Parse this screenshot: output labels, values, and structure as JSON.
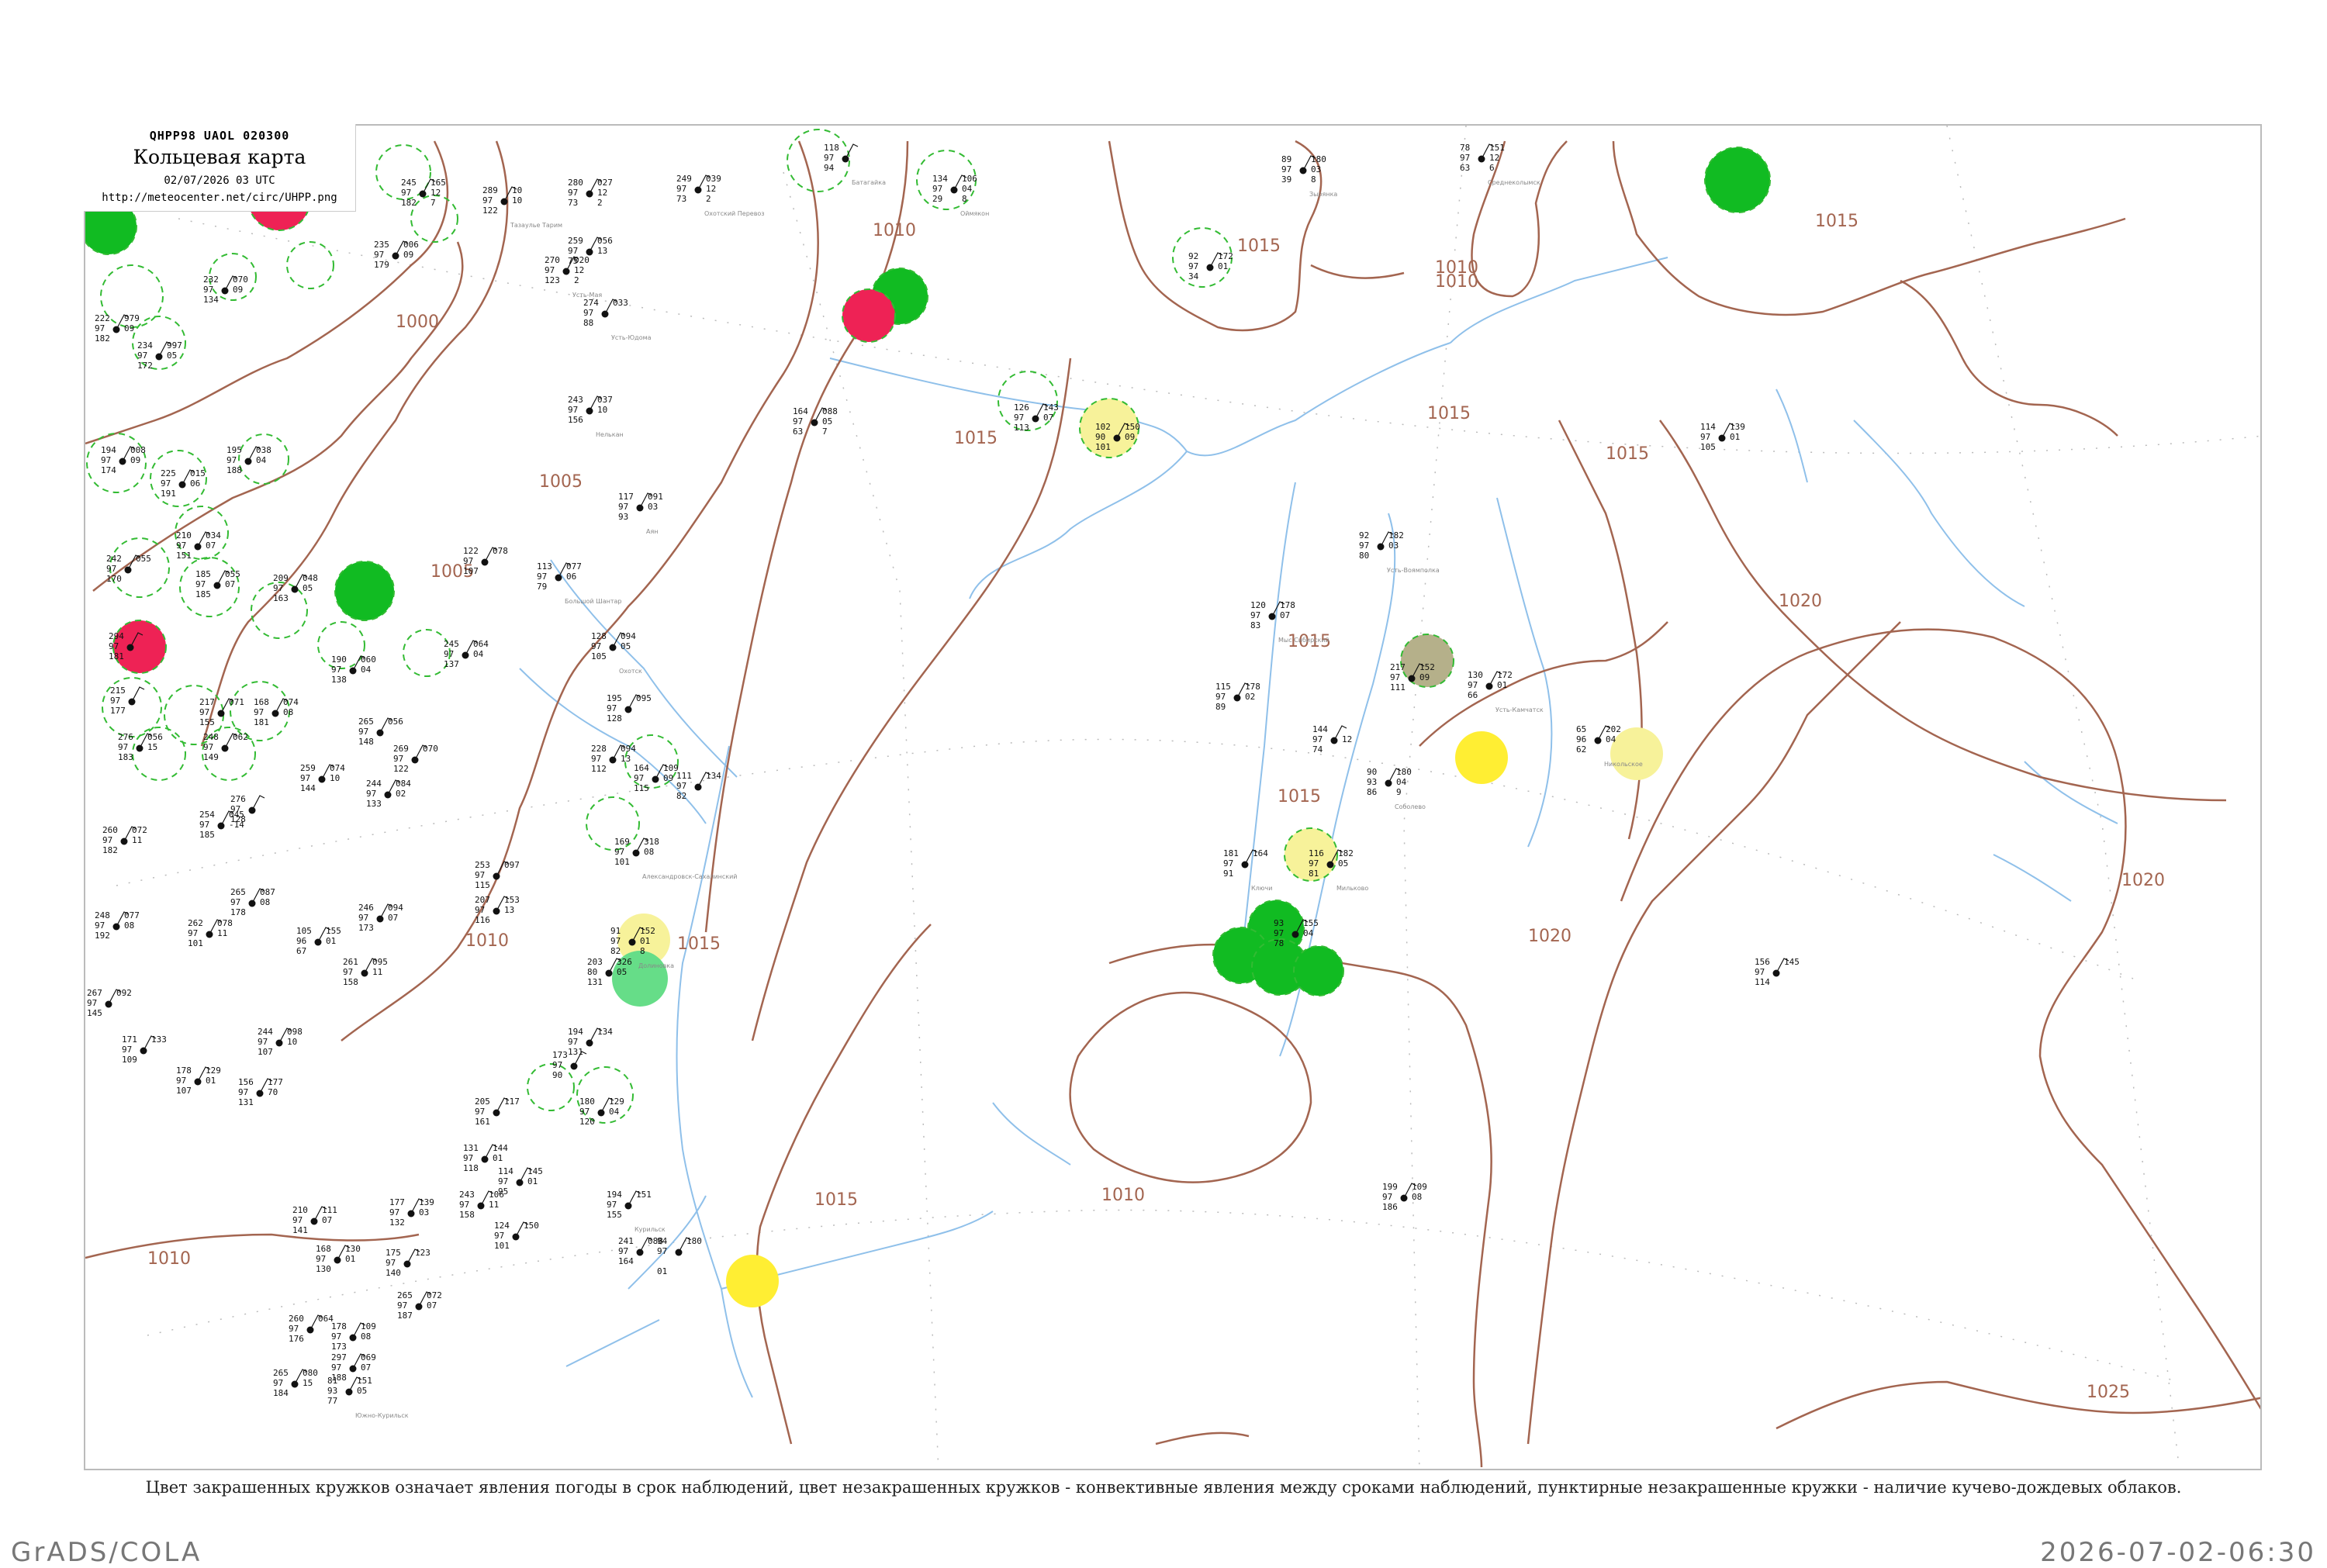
{
  "header": {
    "code": "QHPP98  UAOL  020300",
    "title": "Кольцевая карта",
    "time": "02/07/2026 03 UTC",
    "url": "http://meteocenter.net/circ/UHPP.png"
  },
  "caption": "Цвет закрашенных кружков означает явления погоды в срок наблюдений, цвет незакрашенных кружков - конвективные явления между сроками наблюдений, пунктирные незакрашенные кружки - наличие кучево-дождевых облаков.",
  "footer": {
    "left": "GrADS/COLA",
    "right": "2026-07-02-06:30"
  },
  "colors": {
    "isobar": "#a36550",
    "river": "#8fc0ea",
    "green": "#11bb22",
    "red": "#ee2255",
    "yellow": "#ffee33",
    "pale_yellow": "#f7f29a",
    "light_green": "#66dd88",
    "olive": "#b5b08a",
    "dashed_ring": "#33bb33"
  },
  "isobar_labels": [
    "1000",
    "1005",
    "1005",
    "1010",
    "1010",
    "1010",
    "1010",
    "1015",
    "1015",
    "1015",
    "1015",
    "1015",
    "1015",
    "1015",
    "1015",
    "1015",
    "1020",
    "1020",
    "1020",
    "1025",
    "1010",
    "1010"
  ],
  "stations": [
    {
      "values": [
        "245",
        "97",
        "182"
      ],
      "v2": [
        "165",
        "12",
        "7"
      ],
      "name": ""
    },
    {
      "values": [
        "289",
        "97",
        "122"
      ],
      "v2": [
        "10",
        "10",
        ""
      ],
      "name": "Тазаулье Тарим"
    },
    {
      "values": [
        "280",
        "97",
        "73"
      ],
      "v2": [
        "027",
        "12",
        "2"
      ],
      "name": ""
    },
    {
      "values": [
        "249",
        "97",
        "73"
      ],
      "v2": [
        "039",
        "12",
        "2"
      ],
      "name": "Охотский Перевоз"
    },
    {
      "values": [
        "118",
        "97",
        "94"
      ],
      "v2": [
        "",
        "",
        ""
      ],
      "name": "Батагайка"
    },
    {
      "values": [
        "134",
        "97",
        "29"
      ],
      "v2": [
        "106",
        "04",
        "8"
      ],
      "name": "Оймякон"
    },
    {
      "values": [
        "89",
        "97",
        "39"
      ],
      "v2": [
        "180",
        "03",
        "8"
      ],
      "name": "Зырянка"
    },
    {
      "values": [
        "78",
        "97",
        "63"
      ],
      "v2": [
        "151",
        "12",
        "6"
      ],
      "name": "Среднеколымск"
    },
    {
      "values": [
        "235",
        "97",
        "179"
      ],
      "v2": [
        "006",
        "09",
        ""
      ],
      "name": ""
    },
    {
      "values": [
        "232",
        "97",
        "134"
      ],
      "v2": [
        "070",
        "09",
        ""
      ],
      "name": ""
    },
    {
      "values": [
        "222",
        "97",
        "182"
      ],
      "v2": [
        "979",
        "09",
        ""
      ],
      "name": ""
    },
    {
      "values": [
        "234",
        "97",
        "172"
      ],
      "v2": [
        "997",
        "05",
        ""
      ],
      "name": ""
    },
    {
      "values": [
        "270",
        "97",
        "123"
      ],
      "v2": [
        "020",
        "12",
        "2"
      ],
      "name": "Усть-Мая"
    },
    {
      "values": [
        "259",
        "97",
        "75"
      ],
      "v2": [
        "056",
        "13",
        ""
      ],
      "name": ""
    },
    {
      "values": [
        "274",
        "97",
        "88"
      ],
      "v2": [
        "033",
        "",
        ""
      ],
      "name": "Усть-Юдома"
    },
    {
      "values": [
        "243",
        "97",
        "156"
      ],
      "v2": [
        "037",
        "10",
        ""
      ],
      "name": "Нелькан"
    },
    {
      "values": [
        "164",
        "97",
        "63"
      ],
      "v2": [
        "088",
        "05",
        "7"
      ],
      "name": ""
    },
    {
      "values": [
        "126",
        "97",
        "113"
      ],
      "v2": [
        "143",
        "07",
        ""
      ],
      "name": ""
    },
    {
      "values": [
        "102",
        "90",
        "101"
      ],
      "v2": [
        "150",
        "09",
        ""
      ],
      "name": ""
    },
    {
      "values": [
        "92",
        "97",
        "34"
      ],
      "v2": [
        "172",
        "01",
        ""
      ],
      "name": ""
    },
    {
      "values": [
        "114",
        "97",
        "105"
      ],
      "v2": [
        "139",
        "01",
        ""
      ],
      "name": ""
    },
    {
      "values": [
        "194",
        "97",
        "174"
      ],
      "v2": [
        "008",
        "09",
        ""
      ],
      "name": ""
    },
    {
      "values": [
        "225",
        "97",
        "191"
      ],
      "v2": [
        "015",
        "06",
        ""
      ],
      "name": ""
    },
    {
      "values": [
        "195",
        "97",
        "188"
      ],
      "v2": [
        "038",
        "04",
        ""
      ],
      "name": ""
    },
    {
      "values": [
        "117",
        "97",
        "93"
      ],
      "v2": [
        "091",
        "03",
        ""
      ],
      "name": "Аян"
    },
    {
      "values": [
        "210",
        "97",
        "151"
      ],
      "v2": [
        "034",
        "07",
        ""
      ],
      "name": ""
    },
    {
      "values": [
        "242",
        "97",
        "170"
      ],
      "v2": [
        "055",
        "",
        ""
      ],
      "name": ""
    },
    {
      "values": [
        "185",
        "97",
        "185"
      ],
      "v2": [
        "055",
        "07",
        ""
      ],
      "name": ""
    },
    {
      "values": [
        "113",
        "97",
        "79"
      ],
      "v2": [
        "077",
        "06",
        ""
      ],
      "name": "Большой Шантар"
    },
    {
      "values": [
        "122",
        "97",
        "107"
      ],
      "v2": [
        "078",
        "",
        ""
      ],
      "name": ""
    },
    {
      "values": [
        "209",
        "97",
        "163"
      ],
      "v2": [
        "048",
        "05",
        ""
      ],
      "name": ""
    },
    {
      "values": [
        "92",
        "97",
        "80"
      ],
      "v2": [
        "182",
        "03",
        ""
      ],
      "name": "Усть-Воямполка"
    },
    {
      "values": [
        "120",
        "97",
        "83"
      ],
      "v2": [
        "178",
        "07",
        ""
      ],
      "name": "Мыс Сибирский"
    },
    {
      "values": [
        "294",
        "97",
        "181"
      ],
      "v2": [
        "",
        "",
        ""
      ],
      "name": ""
    },
    {
      "values": [
        "245",
        "97",
        "137"
      ],
      "v2": [
        "064",
        "04",
        ""
      ],
      "name": ""
    },
    {
      "values": [
        "190",
        "97",
        "138"
      ],
      "v2": [
        "060",
        "04",
        ""
      ],
      "name": ""
    },
    {
      "values": [
        "128",
        "97",
        "105"
      ],
      "v2": [
        "094",
        "05",
        ""
      ],
      "name": "Охотск"
    },
    {
      "values": [
        "217",
        "97",
        "111"
      ],
      "v2": [
        "152",
        "09",
        ""
      ],
      "name": ""
    },
    {
      "values": [
        "130",
        "97",
        "66"
      ],
      "v2": [
        "172",
        "01",
        ""
      ],
      "name": "Усть-Камчатск"
    },
    {
      "values": [
        "115",
        "97",
        "89"
      ],
      "v2": [
        "178",
        "02",
        ""
      ],
      "name": ""
    },
    {
      "values": [
        "215",
        "97",
        "177"
      ],
      "v2": [
        "",
        "",
        ""
      ],
      "name": ""
    },
    {
      "values": [
        "217",
        "97",
        "155"
      ],
      "v2": [
        "071",
        "",
        ""
      ],
      "name": ""
    },
    {
      "values": [
        "168",
        "97",
        "181"
      ],
      "v2": [
        "074",
        "08",
        ""
      ],
      "name": ""
    },
    {
      "values": [
        "195",
        "97",
        "128"
      ],
      "v2": [
        "095",
        "",
        ""
      ],
      "name": ""
    },
    {
      "values": [
        "265",
        "97",
        "148"
      ],
      "v2": [
        "056",
        "",
        ""
      ],
      "name": ""
    },
    {
      "values": [
        "144",
        "97",
        "74"
      ],
      "v2": [
        "",
        "12",
        ""
      ],
      "name": ""
    },
    {
      "values": [
        "65",
        "96",
        "62"
      ],
      "v2": [
        "202",
        "04",
        ""
      ],
      "name": "Никольское"
    },
    {
      "values": [
        "276",
        "97",
        "183"
      ],
      "v2": [
        "056",
        "15",
        ""
      ],
      "name": ""
    },
    {
      "values": [
        "248",
        "97",
        "149"
      ],
      "v2": [
        "062",
        "",
        ""
      ],
      "name": ""
    },
    {
      "values": [
        "228",
        "97",
        "112"
      ],
      "v2": [
        "094",
        "13",
        ""
      ],
      "name": ""
    },
    {
      "values": [
        "269",
        "97",
        "122"
      ],
      "v2": [
        "070",
        "",
        ""
      ],
      "name": ""
    },
    {
      "values": [
        "164",
        "97",
        "115"
      ],
      "v2": [
        "109",
        "09",
        ""
      ],
      "name": ""
    },
    {
      "values": [
        "90",
        "93",
        "86"
      ],
      "v2": [
        "180",
        "04",
        "9"
      ],
      "name": "Соболево"
    },
    {
      "values": [
        "259",
        "97",
        "144"
      ],
      "v2": [
        "074",
        "10",
        ""
      ],
      "name": ""
    },
    {
      "values": [
        "244",
        "97",
        "133"
      ],
      "v2": [
        "084",
        "02",
        ""
      ],
      "name": ""
    },
    {
      "values": [
        "111",
        "97",
        "82"
      ],
      "v2": [
        "134",
        "",
        ""
      ],
      "name": ""
    },
    {
      "values": [
        "276",
        "97",
        "128"
      ],
      "v2": [
        "",
        "",
        ""
      ],
      "name": ""
    },
    {
      "values": [
        "254",
        "97",
        "185"
      ],
      "v2": [
        "045",
        "-14",
        ""
      ],
      "name": ""
    },
    {
      "values": [
        "260",
        "97",
        "182"
      ],
      "v2": [
        "072",
        "11",
        ""
      ],
      "name": ""
    },
    {
      "values": [
        "248",
        "97",
        "192"
      ],
      "v2": [
        "077",
        "08",
        ""
      ],
      "name": ""
    },
    {
      "values": [
        "169",
        "97",
        "101"
      ],
      "v2": [
        "318",
        "08",
        ""
      ],
      "name": "Александровск-Сахалинский"
    },
    {
      "values": [
        "116",
        "97",
        "81"
      ],
      "v2": [
        "182",
        "05",
        ""
      ],
      "name": "Мильково"
    },
    {
      "values": [
        "181",
        "97",
        "91"
      ],
      "v2": [
        "164",
        "",
        ""
      ],
      "name": "Ключи"
    },
    {
      "values": [
        "265",
        "97",
        "178"
      ],
      "v2": [
        "087",
        "08",
        ""
      ],
      "name": ""
    },
    {
      "values": [
        "253",
        "97",
        "115"
      ],
      "v2": [
        "097",
        "",
        ""
      ],
      "name": ""
    },
    {
      "values": [
        "207",
        "97",
        "116"
      ],
      "v2": [
        "153",
        "13",
        ""
      ],
      "name": ""
    },
    {
      "values": [
        "246",
        "97",
        "173"
      ],
      "v2": [
        "094",
        "07",
        ""
      ],
      "name": ""
    },
    {
      "values": [
        "262",
        "97",
        "101"
      ],
      "v2": [
        "078",
        "11",
        ""
      ],
      "name": ""
    },
    {
      "values": [
        "105",
        "96",
        "67"
      ],
      "v2": [
        "155",
        "01",
        ""
      ],
      "name": ""
    },
    {
      "values": [
        "91",
        "97",
        "82"
      ],
      "v2": [
        "152",
        "01",
        "8"
      ],
      "name": "Долиновка"
    },
    {
      "values": [
        "93",
        "97",
        "78"
      ],
      "v2": [
        "155",
        "04",
        ""
      ],
      "name": ""
    },
    {
      "values": [
        "203",
        "80",
        "131"
      ],
      "v2": [
        "326",
        "05",
        ""
      ],
      "name": ""
    },
    {
      "values": [
        "194",
        "97",
        "131"
      ],
      "v2": [
        "134",
        "",
        ""
      ],
      "name": ""
    },
    {
      "values": [
        "173",
        "97",
        "90"
      ],
      "v2": [
        "",
        "",
        ""
      ],
      "name": ""
    },
    {
      "values": [
        "244",
        "97",
        "107"
      ],
      "v2": [
        "098",
        "10",
        ""
      ],
      "name": ""
    },
    {
      "values": [
        "261",
        "97",
        "158"
      ],
      "v2": [
        "095",
        "11",
        ""
      ],
      "name": ""
    },
    {
      "values": [
        "267",
        "97",
        "145"
      ],
      "v2": [
        "092",
        "",
        ""
      ],
      "name": ""
    },
    {
      "values": [
        "171",
        "97",
        "109"
      ],
      "v2": [
        "133",
        "",
        ""
      ],
      "name": ""
    },
    {
      "values": [
        "178",
        "97",
        "107"
      ],
      "v2": [
        "129",
        "01",
        ""
      ],
      "name": ""
    },
    {
      "values": [
        "156",
        "97",
        "131"
      ],
      "v2": [
        "177",
        "70",
        ""
      ],
      "name": ""
    },
    {
      "values": [
        "156",
        "97",
        "114"
      ],
      "v2": [
        "145",
        "",
        ""
      ],
      "name": ""
    },
    {
      "values": [
        "180",
        "97",
        "120"
      ],
      "v2": [
        "129",
        "04",
        ""
      ],
      "name": ""
    },
    {
      "values": [
        "205",
        "97",
        "161"
      ],
      "v2": [
        "117",
        "",
        ""
      ],
      "name": ""
    },
    {
      "values": [
        "131",
        "97",
        "118"
      ],
      "v2": [
        "144",
        "01",
        ""
      ],
      "name": ""
    },
    {
      "values": [
        "243",
        "97",
        "158"
      ],
      "v2": [
        "106",
        "11",
        ""
      ],
      "name": ""
    },
    {
      "values": [
        "114",
        "97",
        "95"
      ],
      "v2": [
        "145",
        "01",
        ""
      ],
      "name": ""
    },
    {
      "values": [
        "194",
        "97",
        "155"
      ],
      "v2": [
        "151",
        "",
        ""
      ],
      "name": "Курильск"
    },
    {
      "values": [
        "199",
        "97",
        "186"
      ],
      "v2": [
        "109",
        "08",
        ""
      ],
      "name": ""
    },
    {
      "values": [
        "210",
        "97",
        "141"
      ],
      "v2": [
        "111",
        "07",
        ""
      ],
      "name": ""
    },
    {
      "values": [
        "177",
        "97",
        "132"
      ],
      "v2": [
        "139",
        "03",
        ""
      ],
      "name": ""
    },
    {
      "values": [
        "124",
        "97",
        "101"
      ],
      "v2": [
        "150",
        "",
        ""
      ],
      "name": ""
    },
    {
      "values": [
        "241",
        "97",
        "164"
      ],
      "v2": [
        "088",
        "",
        ""
      ],
      "name": ""
    },
    {
      "values": [
        "168",
        "97",
        "130"
      ],
      "v2": [
        "130",
        "01",
        ""
      ],
      "name": ""
    },
    {
      "values": [
        "175",
        "97",
        "140"
      ],
      "v2": [
        "123",
        "",
        ""
      ],
      "name": ""
    },
    {
      "values": [
        "265",
        "97",
        "187"
      ],
      "v2": [
        "072",
        "07",
        ""
      ],
      "name": ""
    },
    {
      "values": [
        "260",
        "97",
        "176"
      ],
      "v2": [
        "064",
        "",
        ""
      ],
      "name": ""
    },
    {
      "values": [
        "178",
        "97",
        "173"
      ],
      "v2": [
        "109",
        "08",
        ""
      ],
      "name": ""
    },
    {
      "values": [
        "297",
        "97",
        "188"
      ],
      "v2": [
        "069",
        "07",
        ""
      ],
      "name": ""
    },
    {
      "values": [
        "265",
        "97",
        "184"
      ],
      "v2": [
        "080",
        "15",
        ""
      ],
      "name": ""
    },
    {
      "values": [
        "81",
        "93",
        "77"
      ],
      "v2": [
        "151",
        "05",
        ""
      ],
      "name": "Южно-Курильск"
    },
    {
      "values": [
        "94",
        "97",
        "",
        "01"
      ],
      "v2": [
        "180",
        "",
        ""
      ],
      "name": ""
    }
  ]
}
